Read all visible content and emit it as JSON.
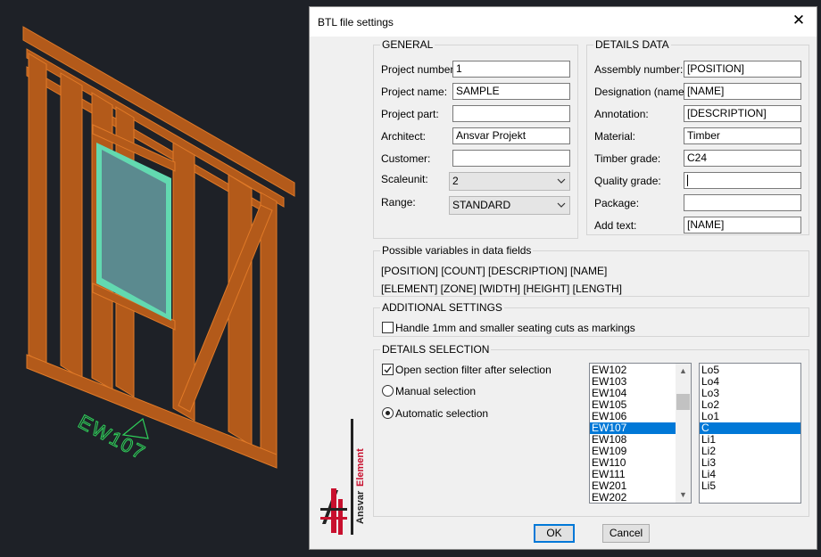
{
  "cad": {
    "wall_label": "EW107"
  },
  "dialog": {
    "title": "BTL file settings",
    "close_icon": "close-icon"
  },
  "general": {
    "title": "GENERAL",
    "project_number": {
      "label": "Project number:",
      "value": "1"
    },
    "project_name": {
      "label": "Project name:",
      "value": "SAMPLE"
    },
    "project_part": {
      "label": "Project part:",
      "value": ""
    },
    "architect": {
      "label": "Architect:",
      "value": "Ansvar Projekt"
    },
    "customer": {
      "label": "Customer:",
      "value": ""
    },
    "scaleunit": {
      "label": "Scaleunit:",
      "value": "2"
    },
    "range": {
      "label": "Range:",
      "value": "STANDARD"
    }
  },
  "details": {
    "title": "DETAILS DATA",
    "assembly_number": {
      "label": "Assembly number:",
      "value": "[POSITION]"
    },
    "designation": {
      "label": "Designation (name):",
      "value": "[NAME]"
    },
    "annotation": {
      "label": "Annotation:",
      "value": "[DESCRIPTION]"
    },
    "material": {
      "label": "Material:",
      "value": "Timber"
    },
    "timber_grade": {
      "label": "Timber grade:",
      "value": "C24"
    },
    "quality_grade": {
      "label": "Quality grade:",
      "value": ""
    },
    "package": {
      "label": "Package:",
      "value": ""
    },
    "add_text": {
      "label": "Add text:",
      "value": "[NAME]"
    }
  },
  "variables": {
    "title": "Possible variables in data fields",
    "line1": "[POSITION] [COUNT] [DESCRIPTION] [NAME]",
    "line2": "[ELEMENT] [ZONE] [WIDTH] [HEIGHT] [LENGTH]"
  },
  "additional": {
    "title": "ADDITIONAL SETTINGS",
    "handle_label": "Handle 1mm and smaller seating cuts as markings",
    "handle_checked": false
  },
  "selection": {
    "title": "DETAILS SELECTION",
    "open_filter_label": "Open section filter after selection",
    "open_filter_checked": true,
    "manual_label": "Manual selection",
    "automatic_label": "Automatic selection",
    "selected_mode": "automatic",
    "elements": [
      "EW102",
      "EW103",
      "EW104",
      "EW105",
      "EW106",
      "EW107",
      "EW108",
      "EW109",
      "EW110",
      "EW111",
      "EW201",
      "EW202"
    ],
    "elements_selected": "EW107",
    "layers": [
      "Lo5",
      "Lo4",
      "Lo3",
      "Lo2",
      "Lo1",
      "C",
      "Li1",
      "Li2",
      "Li3",
      "Li4",
      "Li5"
    ],
    "layers_selected": "C"
  },
  "logo": {
    "text1": "Ansvar",
    "text2": "Element",
    "color_accent": "#c8102e"
  },
  "buttons": {
    "ok": "OK",
    "cancel": "Cancel"
  },
  "colors": {
    "timber": "#d2691e",
    "timber_dark": "#7a3a10",
    "window": "#5b8a8f",
    "window_frame": "#62d9b0",
    "cad_label": "#2fd05a",
    "selection": "#0078d7"
  }
}
